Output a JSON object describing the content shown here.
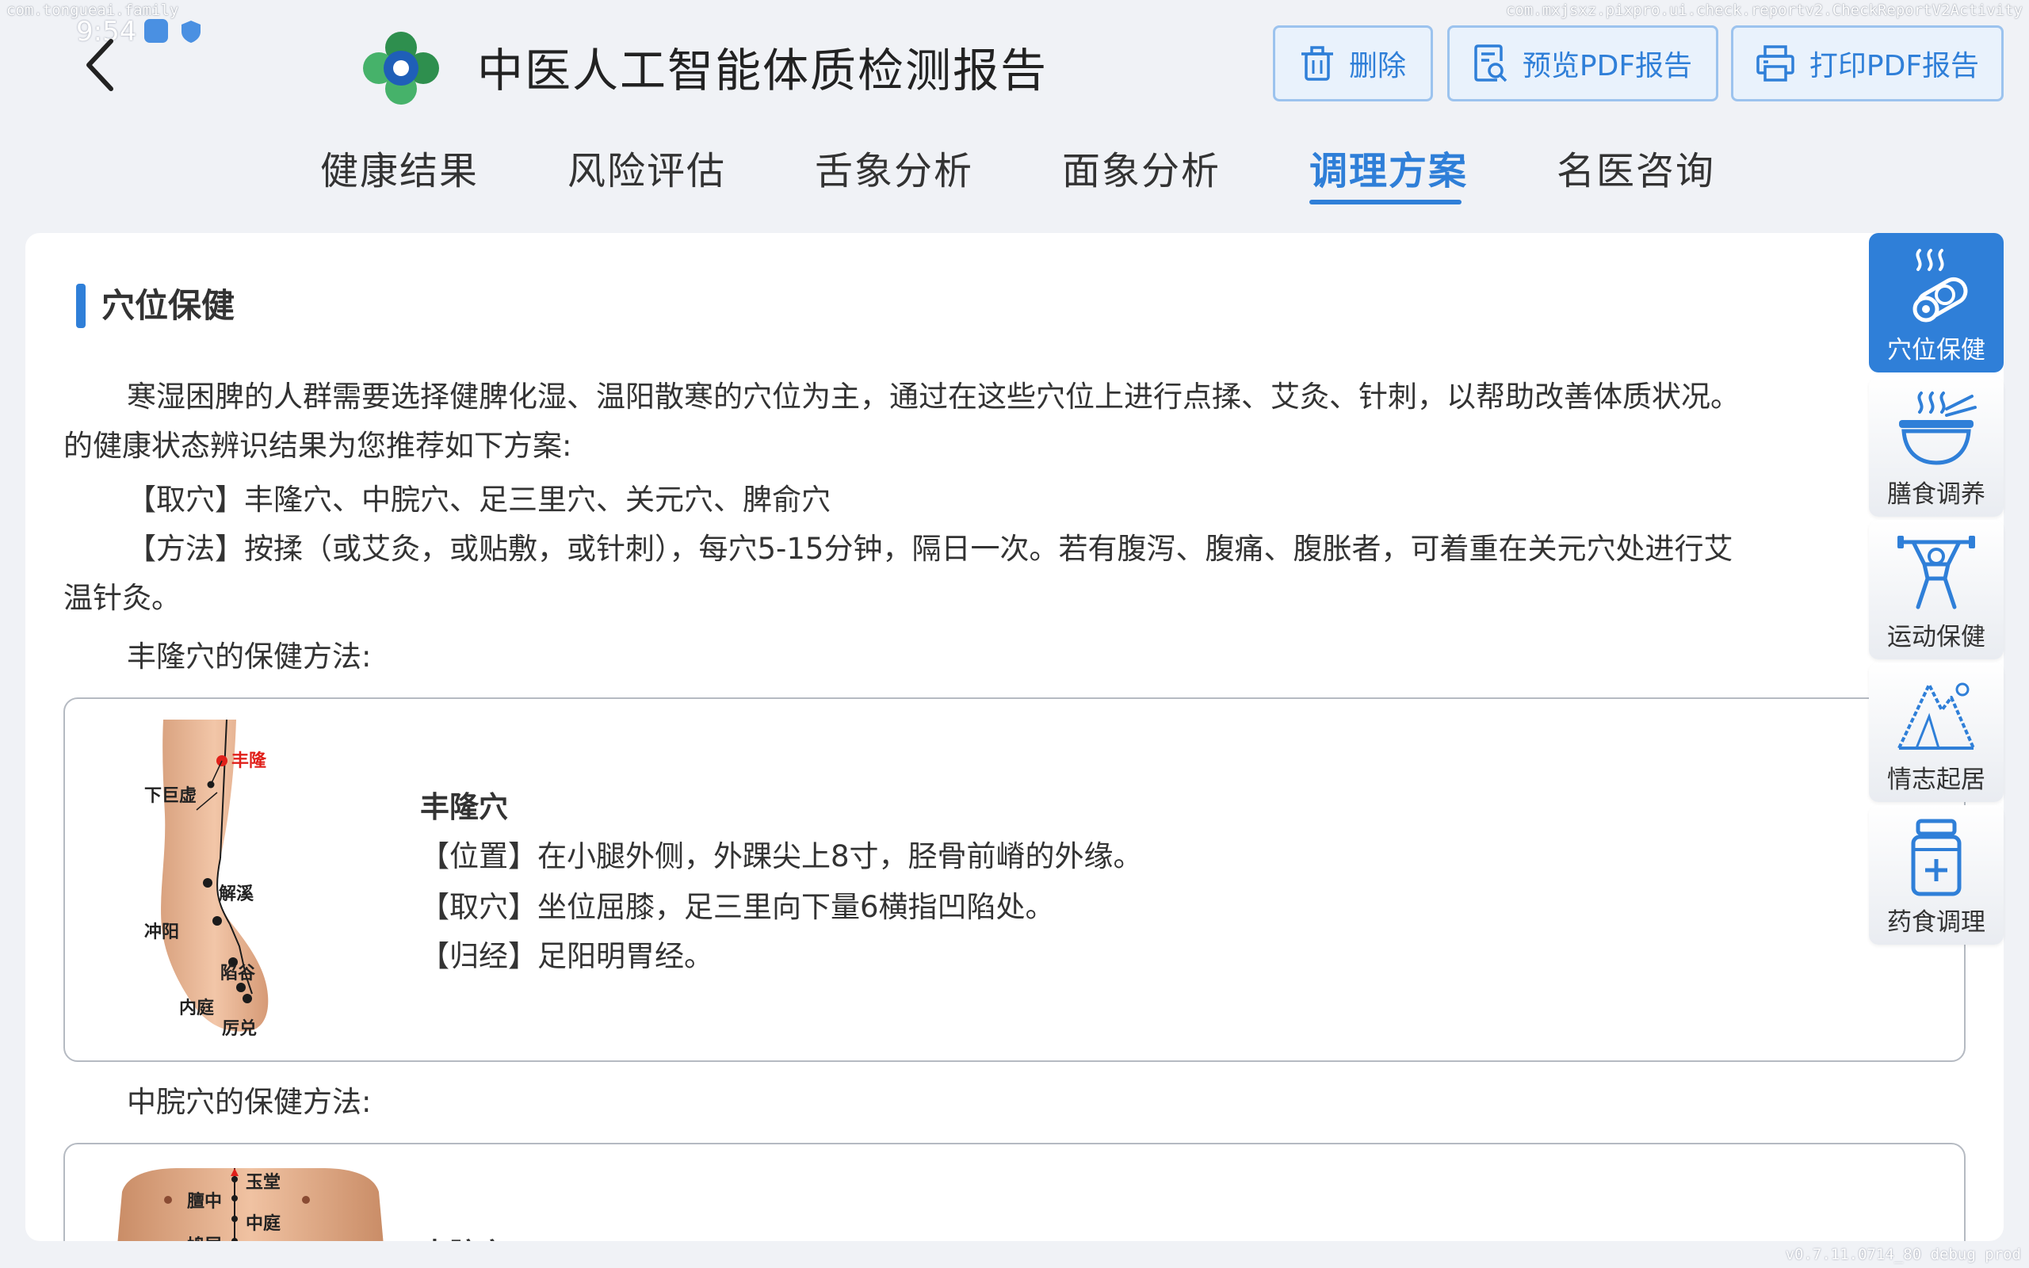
{
  "system": {
    "package_left": "com.tongueai.family",
    "package_right": "com.mxjsxz.pixpro.ui.check.reportv2.CheckReportV2Activity",
    "time": "9:54",
    "build": "v0.7.11.0714_80 debug prod"
  },
  "header": {
    "title": "中医人工智能体质检测报告",
    "buttons": {
      "delete": "删除",
      "preview": "预览PDF报告",
      "print": "打印PDF报告"
    }
  },
  "tabs": [
    "健康结果",
    "风险评估",
    "舌象分析",
    "面象分析",
    "调理方案",
    "名医咨询"
  ],
  "active_tab": "调理方案",
  "section": {
    "title": "穴位保健",
    "intro_1": "寒湿困脾的人群需要选择健脾化湿、温阳散寒的穴位为主，通过在这些穴位上进行点揉、艾灸、针刺，以帮助改善体质状况。",
    "intro_2": "的健康状态辨识结果为您推荐如下方案:",
    "points_line": "【取穴】丰隆穴、中脘穴、足三里穴、关元穴、脾俞穴",
    "method_line_1": "【方法】按揉（或艾灸，或贴敷，或针刺），每穴5-15分钟，隔日一次。若有腹泻、腹痛、腹胀者，可着重在关元穴处进行艾",
    "method_line_2": "温针灸。"
  },
  "points": [
    {
      "heading": "丰隆穴的保健方法:",
      "name": "丰隆穴",
      "location": "【位置】在小腿外侧，外踝尖上8寸，胫骨前嵴的外缘。",
      "finding": "【取穴】坐位屈膝，足三里向下量6横指凹陷处。",
      "meridian": "【归经】足阳明胃经。",
      "image_labels": {
        "fenglong": "丰隆",
        "xiajuxu": "下巨虚",
        "jiexi": "解溪",
        "chongyang": "冲阳",
        "xiangu": "陷谷",
        "neiting": "内庭",
        "lidui": "厉兑"
      }
    },
    {
      "heading": "中脘穴的保健方法:",
      "name": "中脘穴",
      "image_labels": {
        "yutang": "玉堂",
        "danzhong": "膻中",
        "zhongting": "中庭",
        "jiuwei": "鸠尾"
      }
    }
  ],
  "rail": [
    {
      "label": "穴位保健",
      "icon": "acupoint-icon",
      "active": true
    },
    {
      "label": "膳食调养",
      "icon": "bowl-icon",
      "active": false
    },
    {
      "label": "运动保健",
      "icon": "exercise-icon",
      "active": false
    },
    {
      "label": "情志起居",
      "icon": "mountain-icon",
      "active": false
    },
    {
      "label": "药食调理",
      "icon": "medicine-bottle-icon",
      "active": false
    }
  ],
  "colors": {
    "accent": "#2f7fd8",
    "background": "#f0f2f6",
    "acupoint_red": "#e0201a"
  }
}
